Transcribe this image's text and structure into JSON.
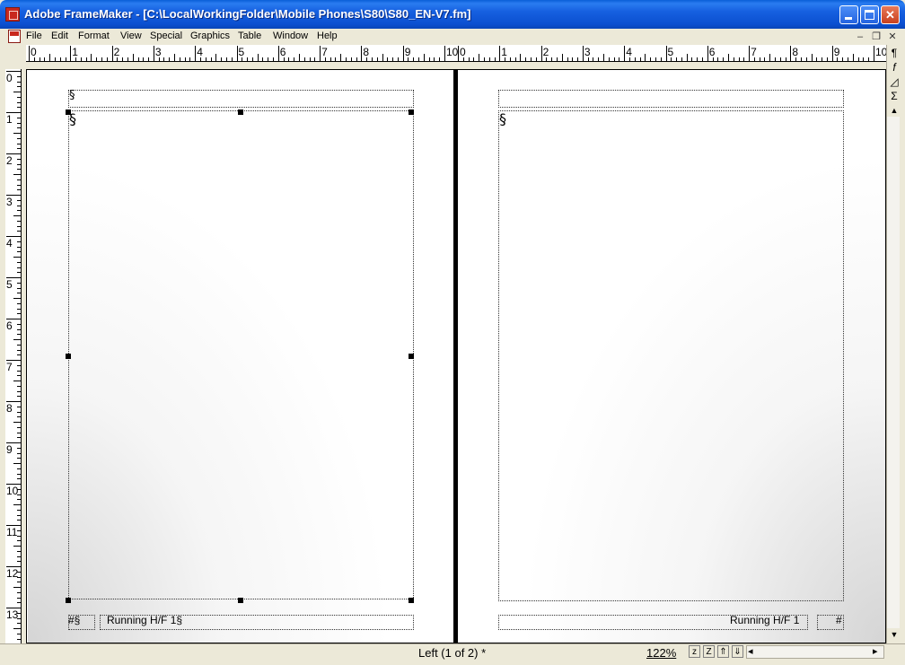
{
  "window": {
    "title": "Adobe FrameMaker - [C:\\LocalWorkingFolder\\Mobile Phones\\S80\\S80_EN-V7.fm]",
    "controls": {
      "minimize": "_",
      "maximize": "□",
      "close": "✕"
    }
  },
  "menubar": {
    "items": [
      "File",
      "Edit",
      "Format",
      "View",
      "Special",
      "Graphics",
      "Table",
      "Window",
      "Help"
    ],
    "mdi_controls": {
      "minimize": "–",
      "restore": "❐",
      "close": "✕"
    }
  },
  "ruler": {
    "horizontal_left": [
      "0",
      "1",
      "2",
      "3",
      "4",
      "5",
      "6",
      "7",
      "8",
      "9",
      "10"
    ],
    "horizontal_right": [
      "0",
      "1",
      "2",
      "3",
      "4",
      "5",
      "6",
      "7",
      "8",
      "9",
      "10"
    ],
    "vertical": [
      "0",
      "1",
      "2",
      "3",
      "4",
      "5",
      "6",
      "7",
      "8",
      "9",
      "10",
      "11",
      "12",
      "13"
    ]
  },
  "tools": {
    "paragraph": "¶",
    "function": "f",
    "graphics": "◿",
    "math": "Σ",
    "scroll_up": "▲",
    "scroll_down": "▼"
  },
  "left_page": {
    "header_mark": "§",
    "body_mark": "§",
    "footer_page_mark": "#§",
    "footer_running": "Running H/F 1§"
  },
  "right_page": {
    "body_mark": "§",
    "footer_running": "Running H/F 1",
    "footer_page_mark": "#"
  },
  "statusbar": {
    "page_status": "Left (1 of 2) *",
    "zoom": "122%",
    "zoom_out": "z",
    "zoom_in": "Z",
    "page_up": "⇑",
    "page_down": "⇓",
    "scroll_left": "◂",
    "scroll_right": "▸"
  }
}
